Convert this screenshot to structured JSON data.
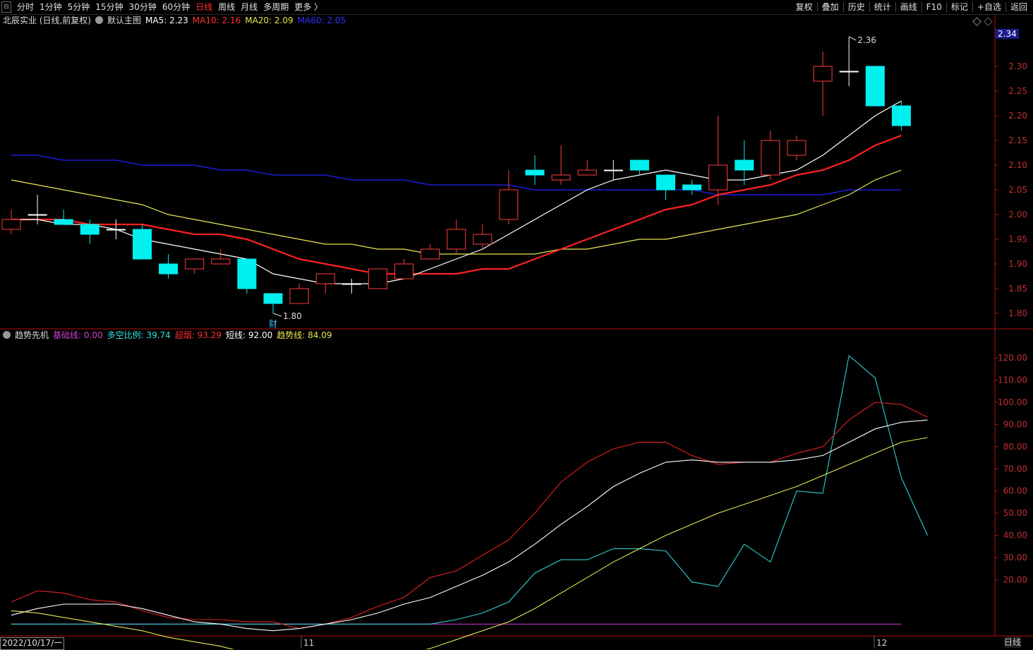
{
  "toolbar": {
    "periods": [
      "分时",
      "1分钟",
      "5分钟",
      "15分钟",
      "30分钟",
      "60分钟",
      "日线",
      "周线",
      "月线",
      "多周期",
      "更多 〉"
    ],
    "active_period": "日线",
    "actions": [
      "复权",
      "叠加",
      "历史",
      "统计",
      "画线",
      "F10",
      "标记",
      "+自选",
      "返回"
    ]
  },
  "main_legend": {
    "stock": "北辰实业 (日线,前复权)",
    "template": "默认主图",
    "ma5": "MA5: 2.23",
    "ma10": "MA10: 2.16",
    "ma20": "MA20: 2.09",
    "ma60": "MA60: 2.05"
  },
  "sub_legend": {
    "name": "趋势先机",
    "base": "基础线: 0.00",
    "ratio": "多空比例: 39.74",
    "overheat": "超烟: 93.29",
    "short": "短线: 92.00",
    "trend": "趋势线: 84.09"
  },
  "current_price": "2.34",
  "high_label": "2.36",
  "low_label": "1.80",
  "event_marker": "财",
  "date_label": "2022/10/17/一",
  "month_labels": [
    "11",
    "12"
  ],
  "period_tag": "日线",
  "colors": {
    "up": "#ff3c3c",
    "down": "#00f0f0",
    "ma5": "#ffffff",
    "ma10": "#ff2020",
    "ma20": "#e8e850",
    "ma60": "#2020ff",
    "axis": "#b01010",
    "base": "#c030c0"
  },
  "chart_data": [
    {
      "type": "candlestick",
      "title": "北辰实业 (日线,前复权)",
      "ylim": [
        1.77,
        2.38
      ],
      "y_ticks": [
        1.8,
        1.85,
        1.9,
        1.95,
        2.0,
        2.05,
        2.1,
        2.15,
        2.2,
        2.25,
        2.3
      ],
      "candles": [
        {
          "o": 1.97,
          "h": 2.01,
          "l": 1.96,
          "c": 1.99
        },
        {
          "o": 2.0,
          "h": 2.04,
          "l": 1.98,
          "c": 2.0
        },
        {
          "o": 1.99,
          "h": 2.01,
          "l": 1.98,
          "c": 1.98
        },
        {
          "o": 1.98,
          "h": 1.99,
          "l": 1.94,
          "c": 1.96
        },
        {
          "o": 1.97,
          "h": 1.99,
          "l": 1.95,
          "c": 1.97
        },
        {
          "o": 1.97,
          "h": 1.98,
          "l": 1.91,
          "c": 1.91
        },
        {
          "o": 1.9,
          "h": 1.92,
          "l": 1.87,
          "c": 1.88
        },
        {
          "o": 1.89,
          "h": 1.91,
          "l": 1.88,
          "c": 1.91
        },
        {
          "o": 1.9,
          "h": 1.93,
          "l": 1.9,
          "c": 1.91
        },
        {
          "o": 1.91,
          "h": 1.91,
          "l": 1.84,
          "c": 1.85
        },
        {
          "o": 1.84,
          "h": 1.84,
          "l": 1.8,
          "c": 1.82
        },
        {
          "o": 1.82,
          "h": 1.86,
          "l": 1.82,
          "c": 1.85
        },
        {
          "o": 1.86,
          "h": 1.88,
          "l": 1.84,
          "c": 1.88
        },
        {
          "o": 1.86,
          "h": 1.87,
          "l": 1.84,
          "c": 1.86
        },
        {
          "o": 1.85,
          "h": 1.89,
          "l": 1.85,
          "c": 1.89
        },
        {
          "o": 1.87,
          "h": 1.91,
          "l": 1.87,
          "c": 1.9
        },
        {
          "o": 1.91,
          "h": 1.94,
          "l": 1.91,
          "c": 1.93
        },
        {
          "o": 1.93,
          "h": 1.99,
          "l": 1.92,
          "c": 1.97
        },
        {
          "o": 1.94,
          "h": 1.98,
          "l": 1.93,
          "c": 1.96
        },
        {
          "o": 1.99,
          "h": 2.09,
          "l": 1.98,
          "c": 2.05
        },
        {
          "o": 2.09,
          "h": 2.12,
          "l": 2.06,
          "c": 2.08
        },
        {
          "o": 2.07,
          "h": 2.14,
          "l": 2.06,
          "c": 2.08
        },
        {
          "o": 2.08,
          "h": 2.11,
          "l": 2.08,
          "c": 2.09
        },
        {
          "o": 2.09,
          "h": 2.11,
          "l": 2.07,
          "c": 2.09
        },
        {
          "o": 2.11,
          "h": 2.11,
          "l": 2.08,
          "c": 2.09
        },
        {
          "o": 2.08,
          "h": 2.08,
          "l": 2.03,
          "c": 2.05
        },
        {
          "o": 2.06,
          "h": 2.07,
          "l": 2.04,
          "c": 2.05
        },
        {
          "o": 2.05,
          "h": 2.2,
          "l": 2.02,
          "c": 2.1
        },
        {
          "o": 2.11,
          "h": 2.15,
          "l": 2.06,
          "c": 2.09
        },
        {
          "o": 2.08,
          "h": 2.17,
          "l": 2.07,
          "c": 2.15
        },
        {
          "o": 2.12,
          "h": 2.16,
          "l": 2.11,
          "c": 2.15
        },
        {
          "o": 2.27,
          "h": 2.33,
          "l": 2.2,
          "c": 2.3
        },
        {
          "o": 2.29,
          "h": 2.36,
          "l": 2.26,
          "c": 2.29
        },
        {
          "o": 2.3,
          "h": 2.3,
          "l": 2.22,
          "c": 2.22
        },
        {
          "o": 2.22,
          "h": 2.23,
          "l": 2.17,
          "c": 2.18
        }
      ],
      "ma5": [
        1.99,
        1.99,
        1.98,
        1.98,
        1.97,
        1.95,
        1.94,
        1.93,
        1.92,
        1.91,
        1.88,
        1.87,
        1.86,
        1.86,
        1.86,
        1.87,
        1.89,
        1.91,
        1.93,
        1.96,
        1.99,
        2.02,
        2.05,
        2.07,
        2.08,
        2.09,
        2.08,
        2.07,
        2.07,
        2.08,
        2.09,
        2.12,
        2.16,
        2.2,
        2.23
      ],
      "ma10": [
        1.99,
        1.99,
        1.99,
        1.98,
        1.98,
        1.98,
        1.97,
        1.96,
        1.96,
        1.95,
        1.93,
        1.91,
        1.9,
        1.89,
        1.88,
        1.88,
        1.88,
        1.88,
        1.89,
        1.89,
        1.91,
        1.93,
        1.95,
        1.97,
        1.99,
        2.01,
        2.02,
        2.04,
        2.05,
        2.06,
        2.08,
        2.09,
        2.11,
        2.14,
        2.16
      ],
      "ma20": [
        2.07,
        2.06,
        2.05,
        2.04,
        2.03,
        2.02,
        2.0,
        1.99,
        1.98,
        1.97,
        1.96,
        1.95,
        1.94,
        1.94,
        1.93,
        1.93,
        1.92,
        1.92,
        1.92,
        1.92,
        1.92,
        1.93,
        1.93,
        1.94,
        1.95,
        1.95,
        1.96,
        1.97,
        1.98,
        1.99,
        2.0,
        2.02,
        2.04,
        2.07,
        2.09
      ],
      "ma60": [
        2.12,
        2.12,
        2.11,
        2.11,
        2.11,
        2.1,
        2.1,
        2.1,
        2.09,
        2.09,
        2.08,
        2.08,
        2.08,
        2.07,
        2.07,
        2.07,
        2.06,
        2.06,
        2.06,
        2.06,
        2.05,
        2.05,
        2.05,
        2.05,
        2.05,
        2.05,
        2.05,
        2.04,
        2.04,
        2.04,
        2.04,
        2.04,
        2.05,
        2.05,
        2.05
      ]
    },
    {
      "type": "line",
      "title": "趋势先机",
      "ylim": [
        -5,
        128
      ],
      "y_ticks": [
        20,
        30,
        40,
        50,
        60,
        70,
        80,
        90,
        100,
        110,
        120
      ],
      "series": [
        {
          "name": "基础线",
          "values": [
            0,
            0,
            0,
            0,
            0,
            0,
            0,
            0,
            0,
            0,
            0,
            0,
            0,
            0,
            0,
            0,
            0,
            0,
            0,
            0,
            0,
            0,
            0,
            0,
            0,
            0,
            0,
            0,
            0,
            0,
            0,
            0,
            0,
            0,
            0
          ]
        },
        {
          "name": "多空比例",
          "values": [
            0,
            0,
            0,
            0,
            0,
            0,
            0,
            0,
            0,
            0,
            0,
            0,
            0,
            0,
            0,
            0,
            0,
            2,
            5,
            10,
            23,
            29,
            29,
            34,
            34,
            33,
            19,
            17,
            36,
            28,
            60,
            59,
            121,
            111,
            66,
            40
          ]
        },
        {
          "name": "超烟",
          "values": [
            10,
            15,
            14,
            11,
            10,
            6,
            3,
            2,
            2,
            1,
            1,
            -2,
            0,
            3,
            8,
            12,
            21,
            24,
            31,
            38,
            50,
            64,
            73,
            79,
            82,
            82,
            76,
            72,
            73,
            73,
            77,
            80,
            92,
            100,
            99,
            93.29
          ]
        },
        {
          "name": "短线",
          "values": [
            4,
            7,
            9,
            9,
            9,
            7,
            4,
            1,
            0,
            -2,
            -3,
            -2,
            0,
            2,
            5,
            9,
            12,
            17,
            22,
            28,
            36,
            45,
            53,
            62,
            68,
            73,
            74,
            73,
            73,
            73,
            74,
            76,
            82,
            88,
            91,
            92
          ]
        },
        {
          "name": "趋势线",
          "values": [
            6,
            5,
            3,
            1,
            -1,
            -3,
            -6,
            -8,
            -10,
            -13,
            -15,
            -16,
            -16,
            -16,
            -15,
            -14,
            -11,
            -7,
            -3,
            1,
            7,
            14,
            21,
            28,
            34,
            40,
            45,
            50,
            54,
            58,
            62,
            67,
            72,
            77,
            82,
            84.09
          ]
        }
      ]
    }
  ]
}
